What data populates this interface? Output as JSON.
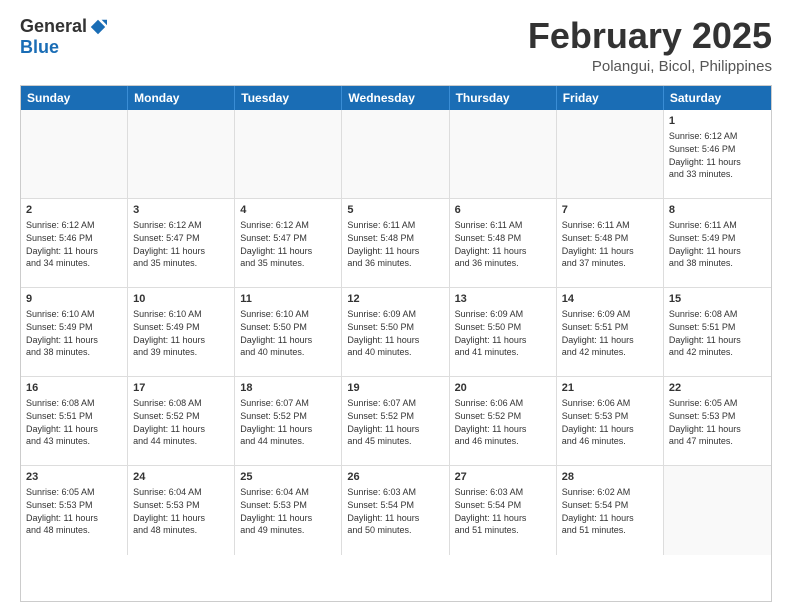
{
  "header": {
    "logo_general": "General",
    "logo_blue": "Blue",
    "month_year": "February 2025",
    "location": "Polangui, Bicol, Philippines"
  },
  "weekdays": [
    "Sunday",
    "Monday",
    "Tuesday",
    "Wednesday",
    "Thursday",
    "Friday",
    "Saturday"
  ],
  "weeks": [
    [
      {
        "day": "",
        "info": ""
      },
      {
        "day": "",
        "info": ""
      },
      {
        "day": "",
        "info": ""
      },
      {
        "day": "",
        "info": ""
      },
      {
        "day": "",
        "info": ""
      },
      {
        "day": "",
        "info": ""
      },
      {
        "day": "1",
        "info": "Sunrise: 6:12 AM\nSunset: 5:46 PM\nDaylight: 11 hours\nand 33 minutes."
      }
    ],
    [
      {
        "day": "2",
        "info": "Sunrise: 6:12 AM\nSunset: 5:46 PM\nDaylight: 11 hours\nand 34 minutes."
      },
      {
        "day": "3",
        "info": "Sunrise: 6:12 AM\nSunset: 5:47 PM\nDaylight: 11 hours\nand 35 minutes."
      },
      {
        "day": "4",
        "info": "Sunrise: 6:12 AM\nSunset: 5:47 PM\nDaylight: 11 hours\nand 35 minutes."
      },
      {
        "day": "5",
        "info": "Sunrise: 6:11 AM\nSunset: 5:48 PM\nDaylight: 11 hours\nand 36 minutes."
      },
      {
        "day": "6",
        "info": "Sunrise: 6:11 AM\nSunset: 5:48 PM\nDaylight: 11 hours\nand 36 minutes."
      },
      {
        "day": "7",
        "info": "Sunrise: 6:11 AM\nSunset: 5:48 PM\nDaylight: 11 hours\nand 37 minutes."
      },
      {
        "day": "8",
        "info": "Sunrise: 6:11 AM\nSunset: 5:49 PM\nDaylight: 11 hours\nand 38 minutes."
      }
    ],
    [
      {
        "day": "9",
        "info": "Sunrise: 6:10 AM\nSunset: 5:49 PM\nDaylight: 11 hours\nand 38 minutes."
      },
      {
        "day": "10",
        "info": "Sunrise: 6:10 AM\nSunset: 5:49 PM\nDaylight: 11 hours\nand 39 minutes."
      },
      {
        "day": "11",
        "info": "Sunrise: 6:10 AM\nSunset: 5:50 PM\nDaylight: 11 hours\nand 40 minutes."
      },
      {
        "day": "12",
        "info": "Sunrise: 6:09 AM\nSunset: 5:50 PM\nDaylight: 11 hours\nand 40 minutes."
      },
      {
        "day": "13",
        "info": "Sunrise: 6:09 AM\nSunset: 5:50 PM\nDaylight: 11 hours\nand 41 minutes."
      },
      {
        "day": "14",
        "info": "Sunrise: 6:09 AM\nSunset: 5:51 PM\nDaylight: 11 hours\nand 42 minutes."
      },
      {
        "day": "15",
        "info": "Sunrise: 6:08 AM\nSunset: 5:51 PM\nDaylight: 11 hours\nand 42 minutes."
      }
    ],
    [
      {
        "day": "16",
        "info": "Sunrise: 6:08 AM\nSunset: 5:51 PM\nDaylight: 11 hours\nand 43 minutes."
      },
      {
        "day": "17",
        "info": "Sunrise: 6:08 AM\nSunset: 5:52 PM\nDaylight: 11 hours\nand 44 minutes."
      },
      {
        "day": "18",
        "info": "Sunrise: 6:07 AM\nSunset: 5:52 PM\nDaylight: 11 hours\nand 44 minutes."
      },
      {
        "day": "19",
        "info": "Sunrise: 6:07 AM\nSunset: 5:52 PM\nDaylight: 11 hours\nand 45 minutes."
      },
      {
        "day": "20",
        "info": "Sunrise: 6:06 AM\nSunset: 5:52 PM\nDaylight: 11 hours\nand 46 minutes."
      },
      {
        "day": "21",
        "info": "Sunrise: 6:06 AM\nSunset: 5:53 PM\nDaylight: 11 hours\nand 46 minutes."
      },
      {
        "day": "22",
        "info": "Sunrise: 6:05 AM\nSunset: 5:53 PM\nDaylight: 11 hours\nand 47 minutes."
      }
    ],
    [
      {
        "day": "23",
        "info": "Sunrise: 6:05 AM\nSunset: 5:53 PM\nDaylight: 11 hours\nand 48 minutes."
      },
      {
        "day": "24",
        "info": "Sunrise: 6:04 AM\nSunset: 5:53 PM\nDaylight: 11 hours\nand 48 minutes."
      },
      {
        "day": "25",
        "info": "Sunrise: 6:04 AM\nSunset: 5:53 PM\nDaylight: 11 hours\nand 49 minutes."
      },
      {
        "day": "26",
        "info": "Sunrise: 6:03 AM\nSunset: 5:54 PM\nDaylight: 11 hours\nand 50 minutes."
      },
      {
        "day": "27",
        "info": "Sunrise: 6:03 AM\nSunset: 5:54 PM\nDaylight: 11 hours\nand 51 minutes."
      },
      {
        "day": "28",
        "info": "Sunrise: 6:02 AM\nSunset: 5:54 PM\nDaylight: 11 hours\nand 51 minutes."
      },
      {
        "day": "",
        "info": ""
      }
    ]
  ]
}
